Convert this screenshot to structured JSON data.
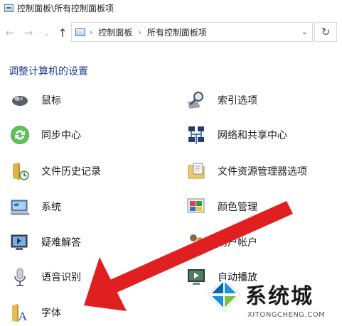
{
  "window": {
    "title": "控制面板\\所有控制面板项"
  },
  "nav": {
    "back": "←",
    "forward": "→",
    "recent": "⌄",
    "up": "↑",
    "breadcrumb": [
      "控制面板",
      "所有控制面板项"
    ],
    "separator": "›",
    "dropdown": "⌄",
    "refresh": "↻"
  },
  "heading": "调整计算机的设置",
  "items": [
    {
      "label": "鼠标",
      "icon": "mouse-icon"
    },
    {
      "label": "索引选项",
      "icon": "indexing-icon"
    },
    {
      "label": "同步中心",
      "icon": "sync-center-icon"
    },
    {
      "label": "网络和共享中心",
      "icon": "network-icon"
    },
    {
      "label": "文件历史记录",
      "icon": "file-history-icon"
    },
    {
      "label": "文件资源管理器选项",
      "icon": "folder-options-icon"
    },
    {
      "label": "系统",
      "icon": "system-icon"
    },
    {
      "label": "颜色管理",
      "icon": "color-management-icon"
    },
    {
      "label": "疑难解答",
      "icon": "troubleshooting-icon"
    },
    {
      "label": "用户帐户",
      "icon": "user-accounts-icon"
    },
    {
      "label": "语音识别",
      "icon": "speech-recognition-icon"
    },
    {
      "label": "自动播放",
      "icon": "autoplay-icon"
    },
    {
      "label": "字体",
      "icon": "fonts-icon"
    }
  ],
  "watermark": {
    "brand": "系统城",
    "url": "XITONGCHENG.COM"
  },
  "colors": {
    "heading": "#1e3e8c",
    "arrow": "#e02020",
    "accent": "#0a66b0"
  }
}
